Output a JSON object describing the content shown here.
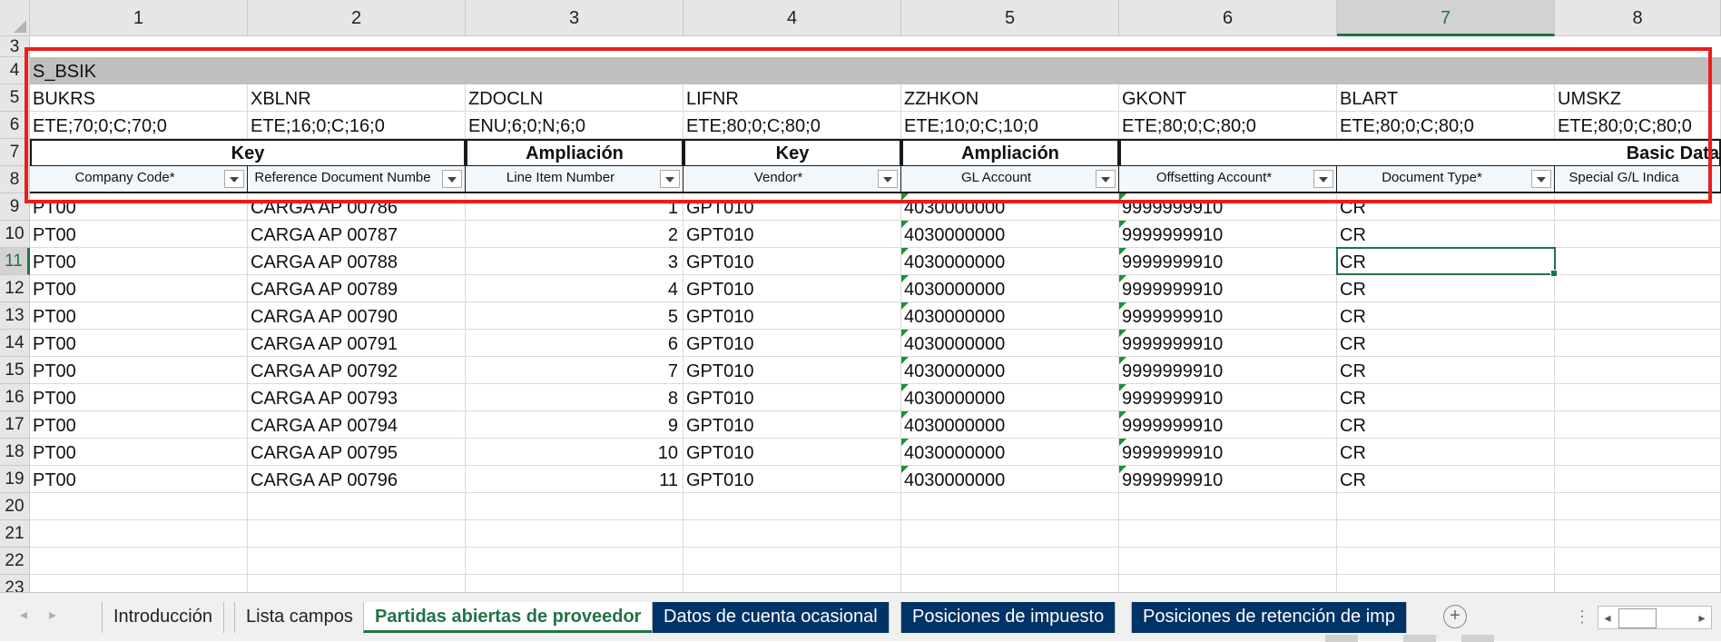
{
  "column_headers": [
    "1",
    "2",
    "3",
    "4",
    "5",
    "6",
    "7",
    "8"
  ],
  "selected_column": "7",
  "row_numbers": [
    "3",
    "4",
    "5",
    "6",
    "7",
    "8",
    "9",
    "10",
    "11",
    "12",
    "13",
    "14",
    "15",
    "16",
    "17",
    "18",
    "19",
    "20",
    "21",
    "22",
    "23"
  ],
  "selected_row": "11",
  "structure_label": "S_BSIK",
  "field_codes": [
    "BUKRS",
    "XBLNR",
    "ZDOCLN",
    "LIFNR",
    "ZZHKON",
    "GKONT",
    "BLART",
    "UMSKZ"
  ],
  "field_specs": [
    "ETE;70;0;C;70;0",
    "ETE;16;0;C;16;0",
    "ENU;6;0;N;6;0",
    "ETE;80;0;C;80;0",
    "ETE;10;0;C;10;0",
    "ETE;80;0;C;80;0",
    "ETE;80;0;C;80;0",
    "ETE;80;0;C;80;0"
  ],
  "group_headers": [
    "Key",
    "Ampliación",
    "Key",
    "Ampliación",
    "Basic Data"
  ],
  "field_names": [
    "Company Code*",
    "Reference Document Numbe",
    "Line Item Number",
    "Vendor*",
    "GL Account",
    "Offsetting Account*",
    "Document Type*",
    "Special G/L Indica"
  ],
  "rows": [
    [
      "PT00",
      "CARGA AP 00786",
      "1",
      "GPT010",
      "4030000000",
      "9999999910",
      "CR"
    ],
    [
      "PT00",
      "CARGA AP 00787",
      "2",
      "GPT010",
      "4030000000",
      "9999999910",
      "CR"
    ],
    [
      "PT00",
      "CARGA AP 00788",
      "3",
      "GPT010",
      "4030000000",
      "9999999910",
      "CR"
    ],
    [
      "PT00",
      "CARGA AP 00789",
      "4",
      "GPT010",
      "4030000000",
      "9999999910",
      "CR"
    ],
    [
      "PT00",
      "CARGA AP 00790",
      "5",
      "GPT010",
      "4030000000",
      "9999999910",
      "CR"
    ],
    [
      "PT00",
      "CARGA AP 00791",
      "6",
      "GPT010",
      "4030000000",
      "9999999910",
      "CR"
    ],
    [
      "PT00",
      "CARGA AP 00792",
      "7",
      "GPT010",
      "4030000000",
      "9999999910",
      "CR"
    ],
    [
      "PT00",
      "CARGA AP 00793",
      "8",
      "GPT010",
      "4030000000",
      "9999999910",
      "CR"
    ],
    [
      "PT00",
      "CARGA AP 00794",
      "9",
      "GPT010",
      "4030000000",
      "9999999910",
      "CR"
    ],
    [
      "PT00",
      "CARGA AP 00795",
      "10",
      "GPT010",
      "4030000000",
      "9999999910",
      "CR"
    ],
    [
      "PT00",
      "CARGA AP 00796",
      "11",
      "GPT010",
      "4030000000",
      "9999999910",
      "CR"
    ]
  ],
  "sheet_tabs": {
    "intro": "Introducción",
    "fields": "Lista campos",
    "active": "Partidas abiertas de proveedor",
    "one_time": "Datos de cuenta ocasional",
    "tax": "Posiciones de impuesto",
    "withholding": "Posiciones de retención de imp"
  },
  "glyphs": {
    "prev": "◂",
    "next": "▸",
    "add": "+",
    "more": "⋮"
  },
  "colors": {
    "excel_green": "#217346",
    "highlight_red": "#ee1c1c",
    "dark_tab": "#003366",
    "band_gray": "#bfbfbf"
  }
}
